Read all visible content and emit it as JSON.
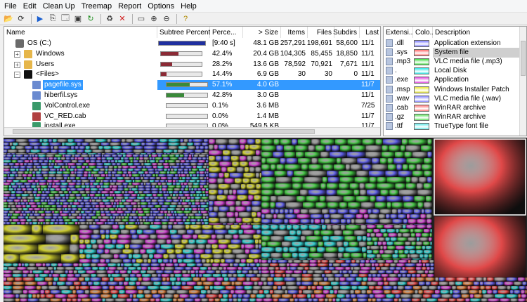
{
  "menu": [
    "File",
    "Edit",
    "Clean Up",
    "Treemap",
    "Report",
    "Options",
    "Help"
  ],
  "toolbar_icons": [
    "open-folder-icon",
    "refresh-icon",
    "play-icon",
    "copy-icon",
    "explorer-icon",
    "command-prompt-icon",
    "refresh-green-icon",
    "recycle-icon",
    "delete-icon",
    "new-folder-icon",
    "zoom-in-icon",
    "zoom-out-icon",
    "help-icon"
  ],
  "tree": {
    "columns": [
      "Name",
      "Subtree Percent...",
      "Perce...",
      "> Size",
      "Items",
      "Files",
      "Subdirs",
      "Last"
    ],
    "rows": [
      {
        "name": "OS (C:)",
        "pct_label": "[9:40 s]",
        "size": "48.1 GB",
        "items": "257,291",
        "files": "198,691",
        "subdirs": "58,600",
        "last": "11/1",
        "bar": 1.0,
        "bar_color": "#1f2f9f",
        "indent": 0,
        "expander": "",
        "icon": "drive-icon",
        "selected": false
      },
      {
        "name": "Windows",
        "pct_label": "42.4%",
        "size": "20.4 GB",
        "items": "104,305",
        "files": "85,455",
        "subdirs": "18,850",
        "last": "11/1",
        "bar": 0.424,
        "bar_color": "#8b2a35",
        "indent": 1,
        "expander": "+",
        "icon": "folder-icon",
        "selected": false
      },
      {
        "name": "Users",
        "pct_label": "28.2%",
        "size": "13.6 GB",
        "items": "78,592",
        "files": "70,921",
        "subdirs": "7,671",
        "last": "11/1",
        "bar": 0.282,
        "bar_color": "#8b2a35",
        "indent": 1,
        "expander": "+",
        "icon": "folder-icon",
        "selected": false
      },
      {
        "name": "<Files>",
        "pct_label": "14.4%",
        "size": "6.9 GB",
        "items": "30",
        "files": "30",
        "subdirs": "0",
        "last": "11/1",
        "bar": 0.144,
        "bar_color": "#8b2a35",
        "indent": 1,
        "expander": "−",
        "icon": "files-icon",
        "selected": false
      },
      {
        "name": "pagefile.sys",
        "pct_label": "57.1%",
        "size": "4.0 GB",
        "items": "",
        "files": "",
        "subdirs": "",
        "last": "11/7",
        "bar": 0.571,
        "bar_color": "#3a8a3a",
        "indent": 2,
        "expander": "",
        "icon": "file-icon",
        "selected": true
      },
      {
        "name": "hiberfil.sys",
        "pct_label": "42.8%",
        "size": "3.0 GB",
        "items": "",
        "files": "",
        "subdirs": "",
        "last": "11/1",
        "bar": 0.428,
        "bar_color": "#3a8a3a",
        "indent": 2,
        "expander": "",
        "icon": "file-icon",
        "selected": false
      },
      {
        "name": "VolControl.exe",
        "pct_label": "0.1%",
        "size": "3.6 MB",
        "items": "",
        "files": "",
        "subdirs": "",
        "last": "7/25",
        "bar": 0.001,
        "bar_color": "#3a8a3a",
        "indent": 2,
        "expander": "",
        "icon": "exe-icon",
        "selected": false
      },
      {
        "name": "VC_RED.cab",
        "pct_label": "0.0%",
        "size": "1.4 MB",
        "items": "",
        "files": "",
        "subdirs": "",
        "last": "11/7",
        "bar": 0.0,
        "bar_color": "#3a8a3a",
        "indent": 2,
        "expander": "",
        "icon": "archive-icon",
        "selected": false
      },
      {
        "name": "install.exe",
        "pct_label": "0.0%",
        "size": "549.5 KB",
        "items": "",
        "files": "",
        "subdirs": "",
        "last": "11/7",
        "bar": 0.0,
        "bar_color": "#3a8a3a",
        "indent": 2,
        "expander": "",
        "icon": "exe-icon",
        "selected": false
      }
    ]
  },
  "extensions": {
    "columns": [
      "Extensi...",
      "Colo...",
      "Description"
    ],
    "rows": [
      {
        "ext": ".dll",
        "color": "#7a7aff",
        "desc": "Application extension",
        "selected": false
      },
      {
        "ext": ".sys",
        "color": "#ff6b6b",
        "desc": "System file",
        "selected": true
      },
      {
        "ext": ".mp3",
        "color": "#3ddc3d",
        "desc": "VLC media file (.mp3)",
        "selected": false
      },
      {
        "ext": ".",
        "color": "#2ee6e6",
        "desc": "Local Disk",
        "selected": false
      },
      {
        "ext": ".exe",
        "color": "#e04be0",
        "desc": "Application",
        "selected": false
      },
      {
        "ext": ".msp",
        "color": "#e8e83a",
        "desc": "Windows Installer Patch",
        "selected": false
      },
      {
        "ext": ".wav",
        "color": "#8a8aff",
        "desc": "VLC media file (.wav)",
        "selected": false
      },
      {
        "ext": ".cab",
        "color": "#ff7a7a",
        "desc": "WinRAR archive",
        "selected": false
      },
      {
        "ext": ".gz",
        "color": "#5ee05e",
        "desc": "WinRAR archive",
        "selected": false
      },
      {
        "ext": ".ttf",
        "color": "#5ee8e8",
        "desc": "TrueType font file",
        "selected": false
      }
    ]
  },
  "treemap_colors": {
    "dll": "#5a5ae0",
    "sys": "#e04848",
    "mp3": "#3fbf3f",
    "local": "#2ec9c9",
    "exe": "#c93fc9",
    "msp": "#c9c92e",
    "gray": "#8a8a8a",
    "orange": "#d07a3a"
  }
}
